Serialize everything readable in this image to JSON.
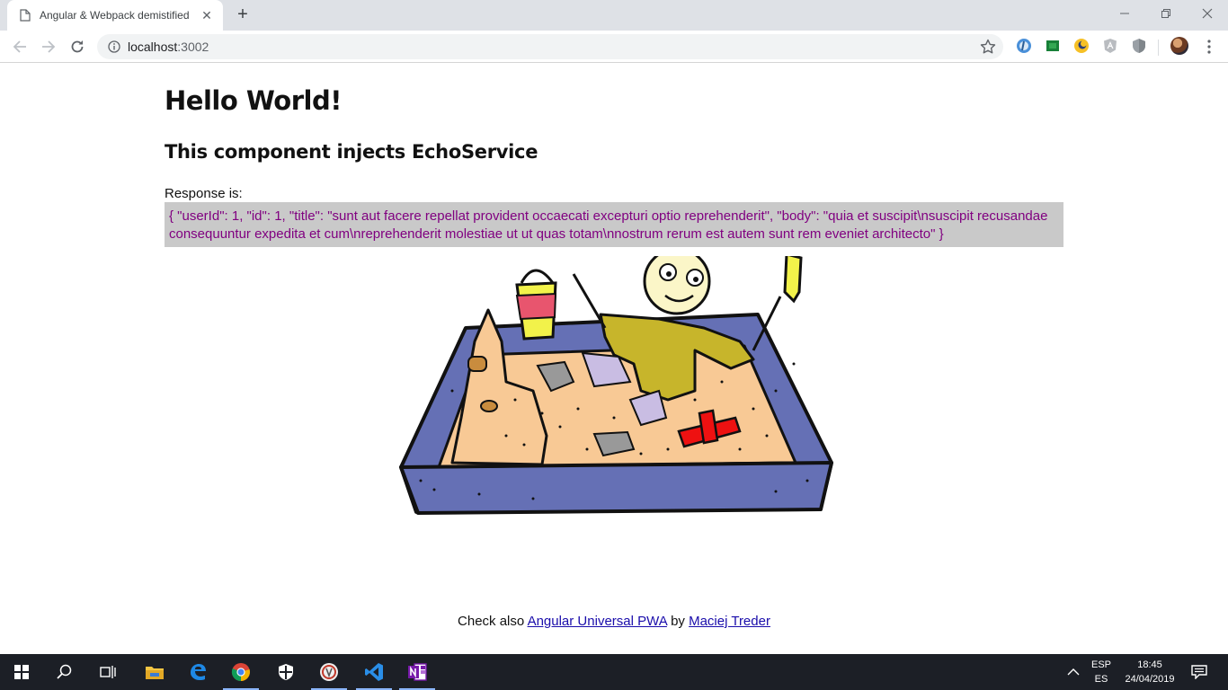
{
  "browser": {
    "tab_title": "Angular & Webpack demistified",
    "url_host": "localhost",
    "url_port": ":3002"
  },
  "page": {
    "heading": "Hello World!",
    "subheading": "This component injects EchoService",
    "response_label": "Response is:",
    "response_json": "{ \"userId\": 1, \"id\": 1, \"title\": \"sunt aut facere repellat provident occaecati excepturi optio reprehenderit\", \"body\": \"quia et suscipit\\nsuscipit recusandae consequuntur expedita et cum\\nreprehenderit molestiae ut ut quas totam\\nnostrum rerum est autem sunt rem eveniet architecto\" }",
    "footer": {
      "prefix": "Check also ",
      "link1": "Angular Universal PWA",
      "middle": " by ",
      "link2": "Maciej Treder"
    }
  },
  "taskbar": {
    "lang_top": "ESP",
    "lang_bottom": "ES",
    "time": "18:45",
    "date": "24/04/2019"
  },
  "icons": [
    "page-icon",
    "close-icon",
    "plus-icon",
    "minimize-icon",
    "restore-icon",
    "back-arrow-icon",
    "forward-arrow-icon",
    "reload-icon",
    "info-icon",
    "star-icon",
    "menu-dots-icon",
    "windows-start-icon",
    "search-icon",
    "task-view-icon",
    "file-explorer-icon",
    "edge-icon",
    "chrome-icon",
    "defender-icon",
    "vscode-icon",
    "onenote-icon",
    "notification-icon"
  ]
}
